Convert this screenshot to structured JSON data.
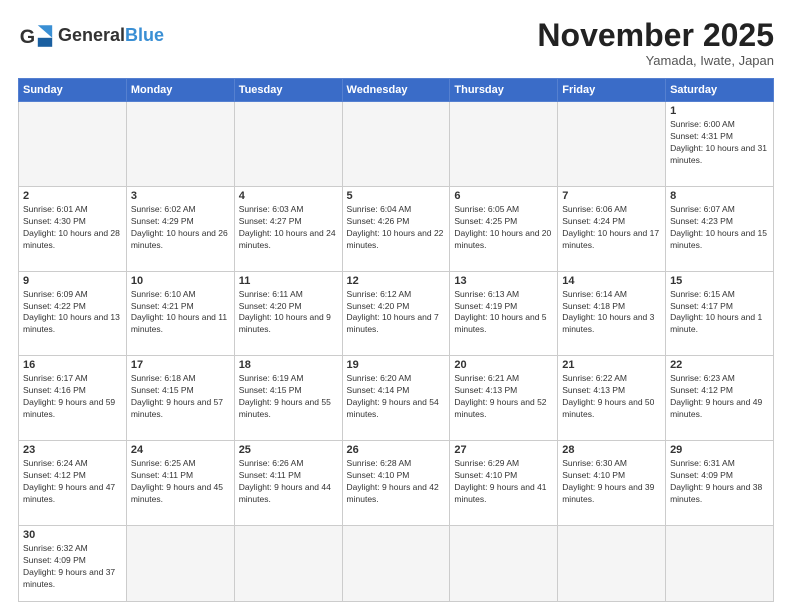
{
  "header": {
    "logo_general": "General",
    "logo_blue": "Blue",
    "month_title": "November 2025",
    "subtitle": "Yamada, Iwate, Japan"
  },
  "days_of_week": [
    "Sunday",
    "Monday",
    "Tuesday",
    "Wednesday",
    "Thursday",
    "Friday",
    "Saturday"
  ],
  "weeks": [
    [
      {
        "day": "",
        "empty": true
      },
      {
        "day": "",
        "empty": true
      },
      {
        "day": "",
        "empty": true
      },
      {
        "day": "",
        "empty": true
      },
      {
        "day": "",
        "empty": true
      },
      {
        "day": "",
        "empty": true
      },
      {
        "day": "1",
        "sunrise": "6:00 AM",
        "sunset": "4:31 PM",
        "daylight": "10 hours and 31 minutes."
      }
    ],
    [
      {
        "day": "2",
        "sunrise": "6:01 AM",
        "sunset": "4:30 PM",
        "daylight": "10 hours and 28 minutes."
      },
      {
        "day": "3",
        "sunrise": "6:02 AM",
        "sunset": "4:29 PM",
        "daylight": "10 hours and 26 minutes."
      },
      {
        "day": "4",
        "sunrise": "6:03 AM",
        "sunset": "4:27 PM",
        "daylight": "10 hours and 24 minutes."
      },
      {
        "day": "5",
        "sunrise": "6:04 AM",
        "sunset": "4:26 PM",
        "daylight": "10 hours and 22 minutes."
      },
      {
        "day": "6",
        "sunrise": "6:05 AM",
        "sunset": "4:25 PM",
        "daylight": "10 hours and 20 minutes."
      },
      {
        "day": "7",
        "sunrise": "6:06 AM",
        "sunset": "4:24 PM",
        "daylight": "10 hours and 17 minutes."
      },
      {
        "day": "8",
        "sunrise": "6:07 AM",
        "sunset": "4:23 PM",
        "daylight": "10 hours and 15 minutes."
      }
    ],
    [
      {
        "day": "9",
        "sunrise": "6:09 AM",
        "sunset": "4:22 PM",
        "daylight": "10 hours and 13 minutes."
      },
      {
        "day": "10",
        "sunrise": "6:10 AM",
        "sunset": "4:21 PM",
        "daylight": "10 hours and 11 minutes."
      },
      {
        "day": "11",
        "sunrise": "6:11 AM",
        "sunset": "4:20 PM",
        "daylight": "10 hours and 9 minutes."
      },
      {
        "day": "12",
        "sunrise": "6:12 AM",
        "sunset": "4:20 PM",
        "daylight": "10 hours and 7 minutes."
      },
      {
        "day": "13",
        "sunrise": "6:13 AM",
        "sunset": "4:19 PM",
        "daylight": "10 hours and 5 minutes."
      },
      {
        "day": "14",
        "sunrise": "6:14 AM",
        "sunset": "4:18 PM",
        "daylight": "10 hours and 3 minutes."
      },
      {
        "day": "15",
        "sunrise": "6:15 AM",
        "sunset": "4:17 PM",
        "daylight": "10 hours and 1 minute."
      }
    ],
    [
      {
        "day": "16",
        "sunrise": "6:17 AM",
        "sunset": "4:16 PM",
        "daylight": "9 hours and 59 minutes."
      },
      {
        "day": "17",
        "sunrise": "6:18 AM",
        "sunset": "4:15 PM",
        "daylight": "9 hours and 57 minutes."
      },
      {
        "day": "18",
        "sunrise": "6:19 AM",
        "sunset": "4:15 PM",
        "daylight": "9 hours and 55 minutes."
      },
      {
        "day": "19",
        "sunrise": "6:20 AM",
        "sunset": "4:14 PM",
        "daylight": "9 hours and 54 minutes."
      },
      {
        "day": "20",
        "sunrise": "6:21 AM",
        "sunset": "4:13 PM",
        "daylight": "9 hours and 52 minutes."
      },
      {
        "day": "21",
        "sunrise": "6:22 AM",
        "sunset": "4:13 PM",
        "daylight": "9 hours and 50 minutes."
      },
      {
        "day": "22",
        "sunrise": "6:23 AM",
        "sunset": "4:12 PM",
        "daylight": "9 hours and 49 minutes."
      }
    ],
    [
      {
        "day": "23",
        "sunrise": "6:24 AM",
        "sunset": "4:12 PM",
        "daylight": "9 hours and 47 minutes."
      },
      {
        "day": "24",
        "sunrise": "6:25 AM",
        "sunset": "4:11 PM",
        "daylight": "9 hours and 45 minutes."
      },
      {
        "day": "25",
        "sunrise": "6:26 AM",
        "sunset": "4:11 PM",
        "daylight": "9 hours and 44 minutes."
      },
      {
        "day": "26",
        "sunrise": "6:28 AM",
        "sunset": "4:10 PM",
        "daylight": "9 hours and 42 minutes."
      },
      {
        "day": "27",
        "sunrise": "6:29 AM",
        "sunset": "4:10 PM",
        "daylight": "9 hours and 41 minutes."
      },
      {
        "day": "28",
        "sunrise": "6:30 AM",
        "sunset": "4:10 PM",
        "daylight": "9 hours and 39 minutes."
      },
      {
        "day": "29",
        "sunrise": "6:31 AM",
        "sunset": "4:09 PM",
        "daylight": "9 hours and 38 minutes."
      }
    ],
    [
      {
        "day": "30",
        "sunrise": "6:32 AM",
        "sunset": "4:09 PM",
        "daylight": "9 hours and 37 minutes."
      },
      {
        "day": "",
        "empty": true
      },
      {
        "day": "",
        "empty": true
      },
      {
        "day": "",
        "empty": true
      },
      {
        "day": "",
        "empty": true
      },
      {
        "day": "",
        "empty": true
      },
      {
        "day": "",
        "empty": true
      }
    ]
  ]
}
